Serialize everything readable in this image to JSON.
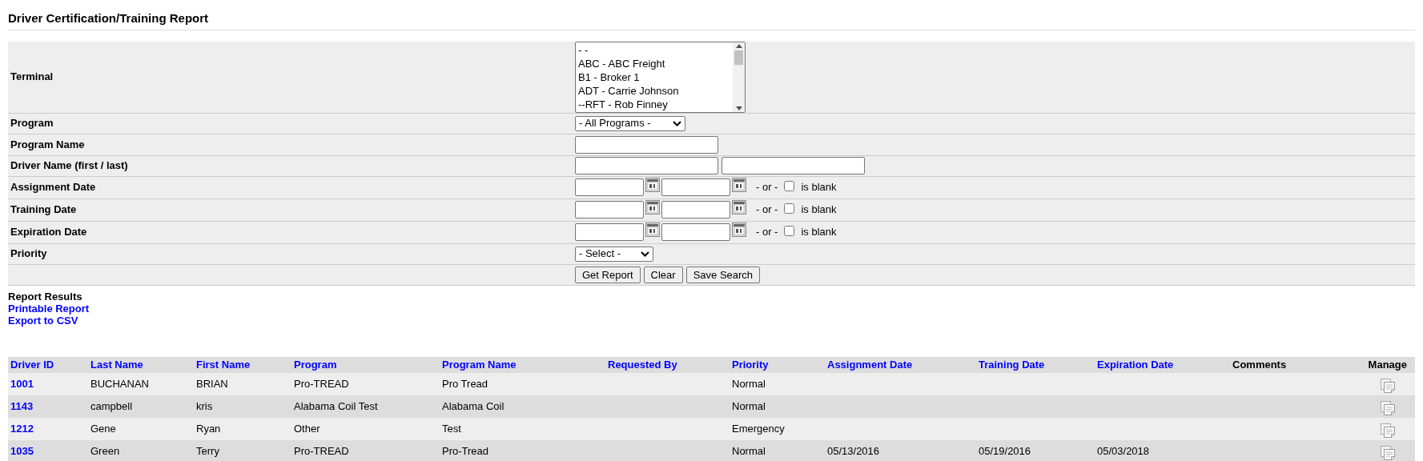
{
  "title": "Driver Certification/Training Report",
  "form": [
    {
      "kind": "listbox",
      "label": "Terminal",
      "options": [
        "- -",
        "ABC - ABC Freight",
        "B1 - Broker 1",
        "ADT - Carrie Johnson",
        "--RFT - Rob Finney"
      ]
    },
    {
      "kind": "select",
      "label": "Program",
      "value": "- All Programs -"
    },
    {
      "kind": "text",
      "label": "Program Name"
    },
    {
      "kind": "text2",
      "label": "Driver Name (first / last)"
    },
    {
      "kind": "daterange",
      "label": "Assignment Date",
      "or_text": "- or -",
      "blank_label": "is blank",
      "is_blank": false
    },
    {
      "kind": "daterange",
      "label": "Training Date",
      "or_text": "- or -",
      "blank_label": "is blank",
      "is_blank": false
    },
    {
      "kind": "daterange",
      "label": "Expiration Date",
      "or_text": "- or -",
      "blank_label": "is blank",
      "is_blank": false
    },
    {
      "kind": "select",
      "label": "Priority",
      "value": "- Select -"
    },
    {
      "kind": "buttons",
      "buttons": [
        "Get Report",
        "Clear",
        "Save Search"
      ]
    }
  ],
  "results": {
    "heading": "Report Results",
    "links": [
      "Printable Report",
      "Export to CSV"
    ]
  },
  "table": {
    "columns": [
      {
        "label": "Driver ID",
        "sortable": true
      },
      {
        "label": "Last Name",
        "sortable": true
      },
      {
        "label": "First Name",
        "sortable": true
      },
      {
        "label": "Program",
        "sortable": true
      },
      {
        "label": "Program Name",
        "sortable": true
      },
      {
        "label": "Requested By",
        "sortable": true
      },
      {
        "label": "Priority",
        "sortable": true
      },
      {
        "label": "Assignment Date",
        "sortable": true
      },
      {
        "label": "Training Date",
        "sortable": true
      },
      {
        "label": "Expiration Date",
        "sortable": true
      },
      {
        "label": "Comments",
        "sortable": false
      },
      {
        "label": "Manage",
        "sortable": false
      }
    ],
    "rows": [
      [
        "1001",
        "BUCHANAN",
        "BRIAN",
        "Pro-TREAD",
        "Pro Tread",
        "",
        "Normal",
        "",
        "",
        "",
        ""
      ],
      [
        "1143",
        "campbell",
        "kris",
        "Alabama Coil Test",
        "Alabama Coil",
        "",
        "Normal",
        "",
        "",
        "",
        ""
      ],
      [
        "1212",
        "Gene",
        "Ryan",
        "Other",
        "Test",
        "",
        "Emergency",
        "",
        "",
        "",
        ""
      ],
      [
        "1035",
        "Green",
        "Terry",
        "Pro-TREAD",
        "Pro-Tread",
        "",
        "Normal",
        "05/13/2016",
        "05/19/2016",
        "05/03/2018",
        ""
      ]
    ]
  }
}
